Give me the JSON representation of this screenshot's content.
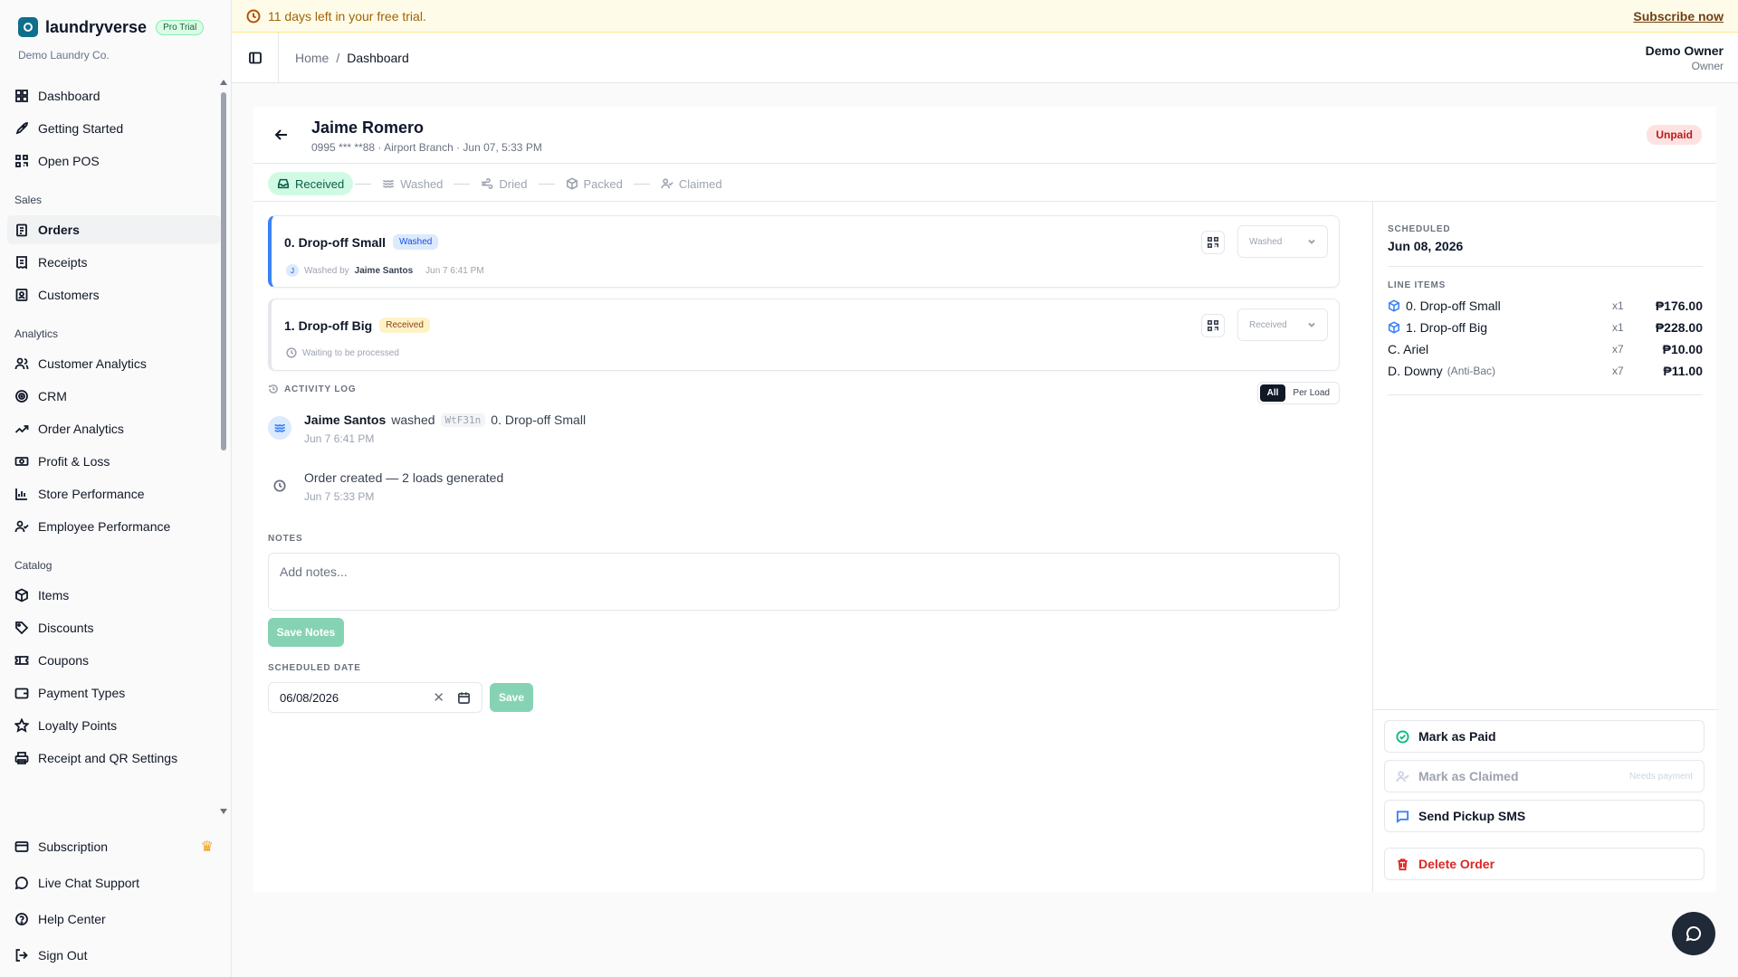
{
  "brand": {
    "name": "laundryverse",
    "badge": "Pro Trial",
    "company": "Demo Laundry Co."
  },
  "sidebar": {
    "top": [
      {
        "label": "Dashboard",
        "icon": "dashboard-icon"
      },
      {
        "label": "Getting Started",
        "icon": "rocket-icon"
      },
      {
        "label": "Open POS",
        "icon": "qr-icon"
      }
    ],
    "sales_label": "Sales",
    "sales": [
      {
        "label": "Orders",
        "icon": "clipboard-icon",
        "active": true
      },
      {
        "label": "Receipts",
        "icon": "receipt-icon"
      },
      {
        "label": "Customers",
        "icon": "contact-icon"
      }
    ],
    "analytics_label": "Analytics",
    "analytics": [
      {
        "label": "Customer Analytics",
        "icon": "users-icon"
      },
      {
        "label": "CRM",
        "icon": "target-icon"
      },
      {
        "label": "Order Analytics",
        "icon": "trend-icon"
      },
      {
        "label": "Profit & Loss",
        "icon": "money-icon"
      },
      {
        "label": "Store Performance",
        "icon": "bar-chart-icon"
      },
      {
        "label": "Employee Performance",
        "icon": "user-check-icon"
      }
    ],
    "catalog_label": "Catalog",
    "catalog": [
      {
        "label": "Items",
        "icon": "box-icon"
      },
      {
        "label": "Discounts",
        "icon": "tag-icon"
      },
      {
        "label": "Coupons",
        "icon": "ticket-icon"
      },
      {
        "label": "Payment Types",
        "icon": "wallet-icon"
      },
      {
        "label": "Loyalty Points",
        "icon": "star-icon"
      },
      {
        "label": "Receipt and QR Settings",
        "icon": "printer-icon"
      }
    ],
    "bottom": [
      {
        "label": "Subscription",
        "icon": "card-icon"
      },
      {
        "label": "Live Chat Support",
        "icon": "chat-icon"
      },
      {
        "label": "Help Center",
        "icon": "help-icon"
      },
      {
        "label": "Sign Out",
        "icon": "logout-icon"
      }
    ]
  },
  "banner": {
    "text": "11 days left in your free trial.",
    "cta": "Subscribe now"
  },
  "header": {
    "crumb_home": "Home",
    "crumb_sep": "/",
    "crumb_current": "Dashboard",
    "user_name": "Demo Owner",
    "user_role": "Owner"
  },
  "order": {
    "customer": "Jaime Romero",
    "meta": "0995 *** **88 · Airport Branch · Jun 07, 5:33 PM",
    "payment_status": "Unpaid",
    "steps": [
      "Received",
      "Washed",
      "Dried",
      "Packed",
      "Claimed"
    ],
    "loads": [
      {
        "title": "0. Drop-off Small",
        "status": "Washed",
        "avatar": "J",
        "sub_prefix": "Washed by",
        "sub_who": "Jaime Santos",
        "sub_time": "Jun 7 6:41 PM",
        "select": "Washed"
      },
      {
        "title": "1. Drop-off Big",
        "status": "Received",
        "sub_text": "Waiting to be processed",
        "select": "Received"
      }
    ],
    "activity_label": "ACTIVITY LOG",
    "activity_filter": {
      "all": "All",
      "per_load": "Per Load"
    },
    "activity": [
      {
        "who": "Jaime Santos",
        "verb": "washed",
        "code": "WtF31n",
        "target": "0. Drop-off Small",
        "time": "Jun 7 6:41 PM"
      },
      {
        "text": "Order created — 2 loads generated",
        "time": "Jun 7 5:33 PM"
      }
    ],
    "notes_label": "NOTES",
    "notes_placeholder": "Add notes...",
    "save_notes": "Save Notes",
    "scheduled_label": "SCHEDULED DATE",
    "scheduled_value": "06/08/2026",
    "save": "Save"
  },
  "summary": {
    "scheduled_label": "SCHEDULED",
    "scheduled_date": "Jun 08, 2026",
    "line_items_label": "LINE ITEMS",
    "items": [
      {
        "name": "0. Drop-off Small",
        "qty": "x1",
        "amount": "₱176.00",
        "icon": true
      },
      {
        "name": "1. Drop-off Big",
        "qty": "x1",
        "amount": "₱228.00",
        "icon": true
      },
      {
        "name": "C. Ariel",
        "qty": "x7",
        "amount": "₱10.00"
      },
      {
        "name": "D. Downy",
        "note": "(Anti-Bac)",
        "qty": "x7",
        "amount": "₱11.00"
      }
    ],
    "actions": {
      "mark_paid": "Mark as Paid",
      "mark_claimed": "Mark as Claimed",
      "claimed_hint": "Needs payment",
      "send_sms": "Send Pickup SMS",
      "delete": "Delete Order"
    }
  },
  "colors": {
    "accent_green": "#86d3b4",
    "danger": "#dc2626",
    "washed_blue": "#3b82f6",
    "unpaid_red": "#b91c1c"
  }
}
